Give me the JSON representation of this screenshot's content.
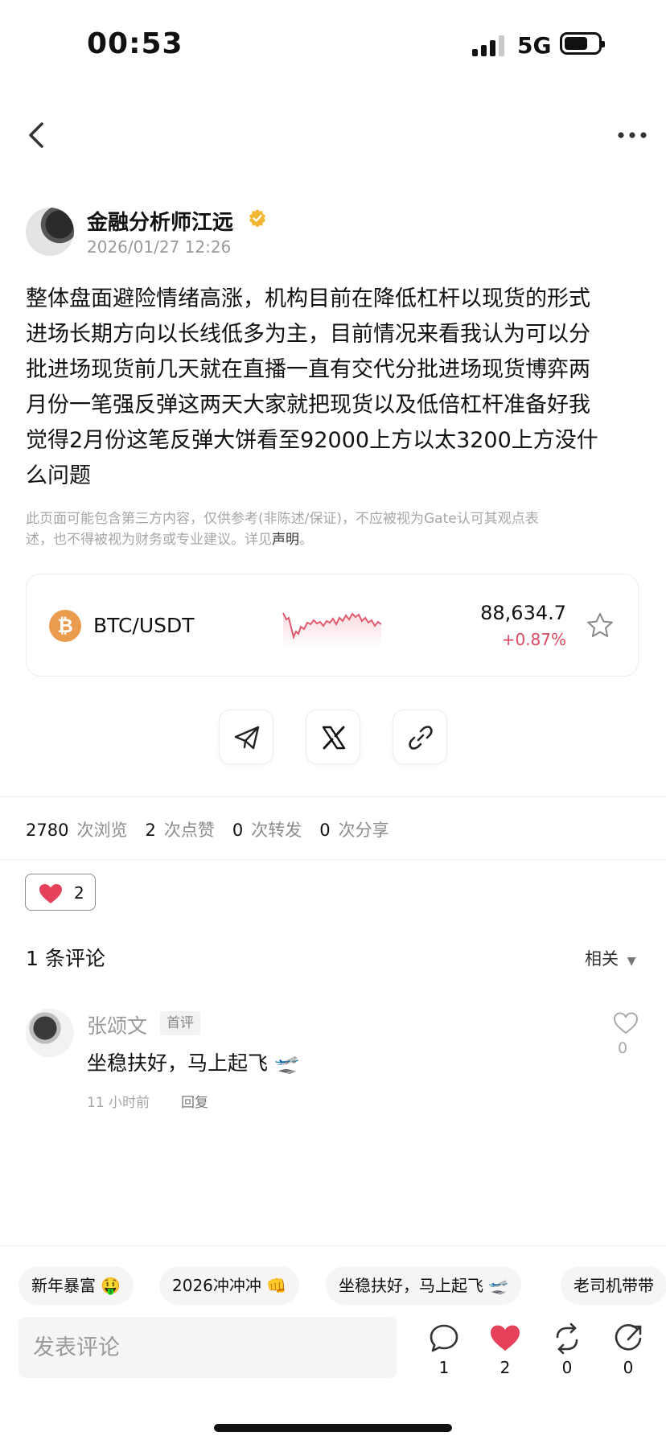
{
  "status_bar": {
    "time": "00:53",
    "network": "5G"
  },
  "post": {
    "author": "金融分析师江远",
    "timestamp": "2026/01/27 12:26",
    "body": "整体盘面避险情绪高涨，机构目前在降低杠杆以现货的形式\n进场长期方向以长线低多为主，目前情况来看我认为可以分\n批进场现货前几天就在直播一直有交代分批进场现货博弈两\n月份一笔强反弹这两天大家就把现货以及低倍杠杆准备好我\n觉得2月份这笔反弹大饼看至92000上方以太3200上方没什\n么问题",
    "disclaimer": "此页面可能包含第三方内容，仅供参考(非陈述/保证)，不应被视为Gate认可其观点表\n述，也不得被视为财务或专业建议。详见",
    "disclaimer_link": "声明",
    "disclaimer_end": "。"
  },
  "ticker": {
    "pair": "BTC/USDT",
    "price": "88,634.7",
    "change": "+0.87%",
    "coin_symbol": "₿",
    "change_color": "#d94a62",
    "coin_color": "#eb9b4e"
  },
  "share": {
    "icons": [
      "telegram-icon",
      "x-icon",
      "link-icon"
    ]
  },
  "stats": {
    "views": "2780",
    "views_label": "次浏览",
    "likes": "2",
    "likes_label": "次点赞",
    "reposts": "0",
    "reposts_label": "次转发",
    "shares": "0",
    "shares_label": "次分享"
  },
  "like_chip": {
    "count": "2"
  },
  "comments": {
    "title": "1 条评论",
    "sort_label": "相关",
    "items": [
      {
        "name": "张颂文",
        "badge": "首评",
        "text": "坐稳扶好，马上起飞 🛫",
        "time": "11 小时前",
        "reply_label": "回复",
        "likes": "0"
      }
    ]
  },
  "quick_replies": [
    "新年暴富 🤑",
    "2026冲冲冲 👊",
    "坐稳扶好，马上起飞 🛫",
    "老司机带带"
  ],
  "bottom_bar": {
    "input_placeholder": "发表评论",
    "comment_count": "1",
    "like_count": "2",
    "repost_count": "0",
    "share_count": "0"
  }
}
